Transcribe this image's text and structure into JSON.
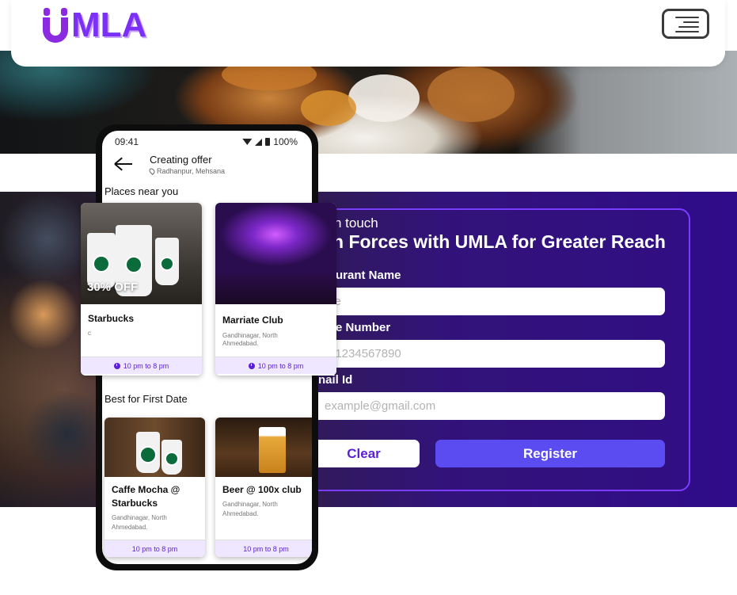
{
  "header": {
    "logo_text": "MLA",
    "menu_icon": "hamburger-menu-icon"
  },
  "contact": {
    "kicker": "n touch",
    "title": "n Forces with UMLA for Greater Reach",
    "fields": [
      {
        "label": "urant Name",
        "placeholder": "me"
      },
      {
        "label": "e Number",
        "placeholder": "1-1234567890"
      },
      {
        "label": "nail Id",
        "placeholder": "example@gmail.com"
      }
    ],
    "clear_label": "Clear",
    "register_label": "Register"
  },
  "phone": {
    "time": "09:41",
    "battery": "100%",
    "screen_title": "Creating offer",
    "location": "Radhanpur, Mehsana",
    "section_near": "Places near you",
    "section_date": "Best for First Date",
    "near_cards": [
      {
        "name": "Starbucks",
        "address": "c",
        "offer": "30% OFF",
        "time": "10 pm to 8 pm"
      },
      {
        "name": "Marriate Club",
        "address_line1": "Gandhinagar, North",
        "address_line2": "Ahmedabad.",
        "time": "10 pm to 8 pm"
      }
    ],
    "date_cards": [
      {
        "name_line1": "Caffe Mocha @",
        "name_line2": "Starbucks",
        "address_line1": "Gandhinagar, North",
        "address_line2": "Ahmedabad.",
        "time": "10 pm to 8 pm"
      },
      {
        "name": "Beer @ 100x club",
        "address_line1": "Gandhinagar, North",
        "address_line2": "Ahmedabad.",
        "time": "10 pm to 8 pm"
      }
    ]
  },
  "colors": {
    "brand_purple": "#7b2ff7",
    "accent_blue": "#5a4cf0",
    "section_purple": "#300c8a"
  }
}
